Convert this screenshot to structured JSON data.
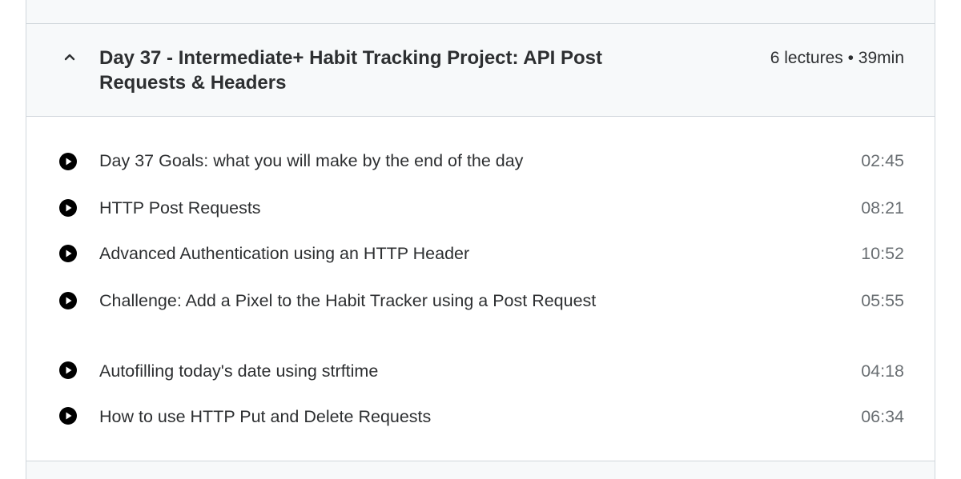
{
  "section": {
    "title": "Day 37 - Intermediate+ Habit Tracking Project: API Post Requests & Headers",
    "meta": "6 lectures • 39min",
    "expanded_icon": "chevron-up-icon"
  },
  "lectures": [
    {
      "title": "Day 37 Goals: what you will make by the end of the day",
      "duration": "02:45",
      "icon": "play-circle-icon"
    },
    {
      "title": "HTTP Post Requests",
      "duration": "08:21",
      "icon": "play-circle-icon"
    },
    {
      "title": "Advanced Authentication using an HTTP Header",
      "duration": "10:52",
      "icon": "play-circle-icon"
    },
    {
      "title": "Challenge: Add a Pixel to the Habit Tracker using a Post Request",
      "duration": "05:55",
      "icon": "play-circle-icon"
    },
    {
      "title": "Autofilling today's date using strftime",
      "duration": "04:18",
      "icon": "play-circle-icon"
    },
    {
      "title": "How to use HTTP Put and Delete Requests",
      "duration": "06:34",
      "icon": "play-circle-icon"
    }
  ]
}
